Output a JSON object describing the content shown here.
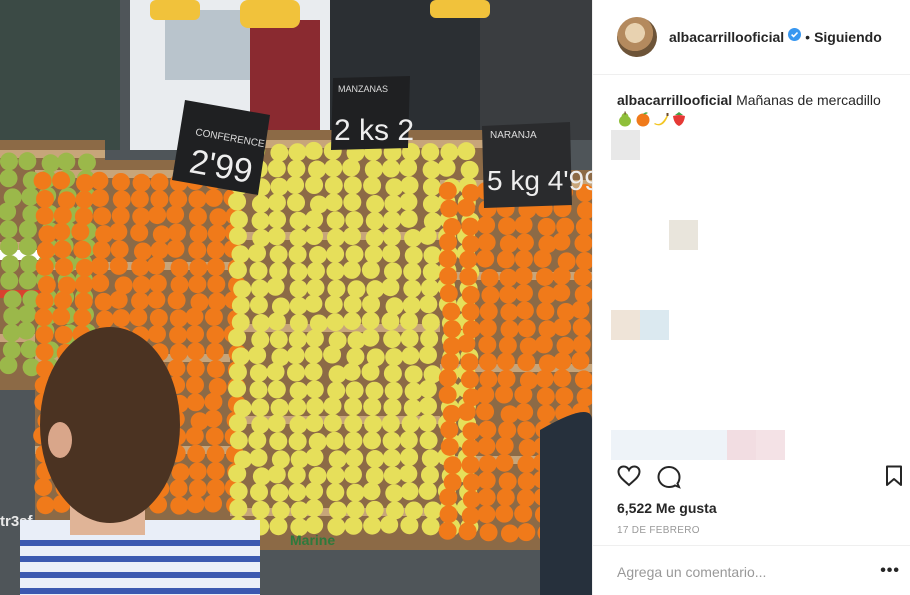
{
  "post": {
    "username": "albacarrillooficial",
    "follow_status": "Siguiendo",
    "caption_user": "albacarrillooficial",
    "caption_text": "Mañanas de mercadillo",
    "caption_emojis": [
      "pear-emoji",
      "tangerine-emoji",
      "banana-emoji",
      "strawberry-emoji"
    ],
    "likes": "6,522 Me gusta",
    "date": "17 DE FEBRERO",
    "comment_placeholder": "Agrega un comentario...",
    "more_options": "•••"
  },
  "photo": {
    "signs": {
      "left": "2'99",
      "left_top": "CONFERENCE",
      "middle_top": "MANZANAS",
      "middle": "2 ks 2",
      "right_top": "NARANJA",
      "right": "5 kg 4'99"
    },
    "box_print_left": "tr3sf",
    "box_print_bottom": "Marine"
  },
  "colors": {
    "verified": "#3897f0",
    "text": "#262626",
    "muted": "#999999",
    "orange": "#f07a1a",
    "apple": "#e6df5a",
    "pear": "#9bb84a"
  }
}
